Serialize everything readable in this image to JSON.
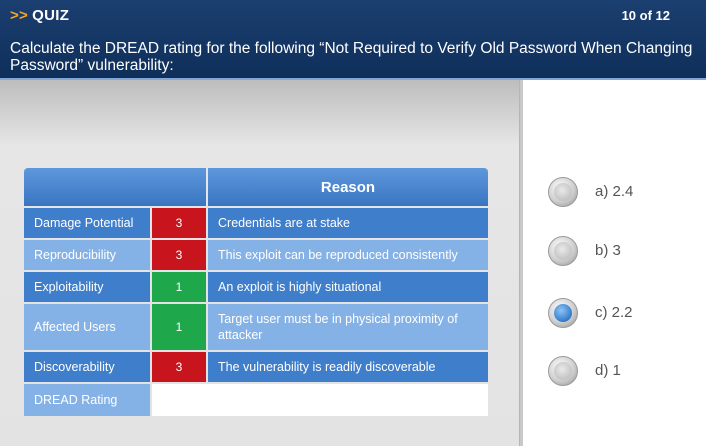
{
  "header": {
    "arrows": ">>",
    "title": "QUIZ",
    "counter": "10 of 12",
    "question": "Calculate the DREAD rating for the following “Not Required to Verify Old Password When Changing Password” vulnerability:"
  },
  "table": {
    "reason_header": "Reason",
    "rows": [
      {
        "label": "Damage Potential",
        "score": "3",
        "reason": "Credentials are at stake",
        "color": "#c8151d"
      },
      {
        "label": "Reproducibility",
        "score": "3",
        "reason": "This exploit can be reproduced consistently",
        "color": "#c8151d"
      },
      {
        "label": "Exploitability",
        "score": "1",
        "reason": "An exploit is highly situational",
        "color": "#1fa74b"
      },
      {
        "label": "Affected Users",
        "score": "1",
        "reason": "Target user must be in physical proximity of attacker",
        "color": "#1fa74b"
      },
      {
        "label": "Discoverability",
        "score": "3",
        "reason": "The vulnerability is readily discoverable",
        "color": "#c8151d"
      }
    ],
    "rating_label": "DREAD Rating"
  },
  "options": [
    {
      "label": "a)",
      "value": "2.4",
      "selected": false
    },
    {
      "label": "b)",
      "value": "3",
      "selected": false
    },
    {
      "label": "c)",
      "value": "2.2",
      "selected": true
    },
    {
      "label": "d)",
      "value": "1",
      "selected": false
    }
  ]
}
